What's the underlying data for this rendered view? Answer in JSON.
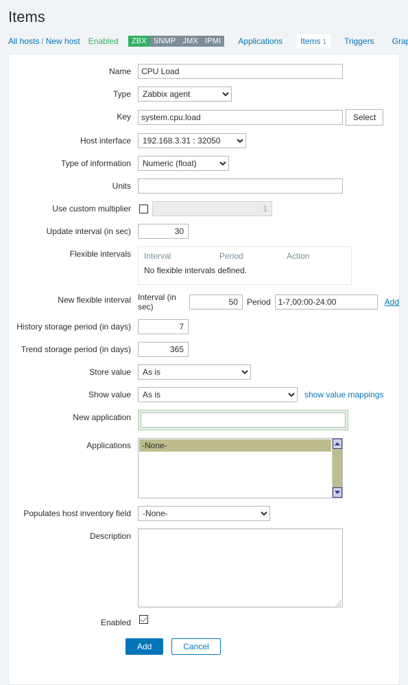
{
  "header": {
    "title": "Items"
  },
  "breadcrumb": {
    "all_hosts": "All hosts",
    "separator": "/",
    "host_name": "New host",
    "status": "Enabled",
    "interface_badges": [
      {
        "label": "ZBX",
        "active": true
      },
      {
        "label": "SNMP",
        "active": false
      },
      {
        "label": "JMX",
        "active": false
      },
      {
        "label": "IPMI",
        "active": false
      }
    ],
    "tabs": [
      {
        "label": "Applications",
        "active": false,
        "count": ""
      },
      {
        "label": "Items",
        "active": true,
        "count": "1"
      },
      {
        "label": "Triggers",
        "active": false,
        "count": ""
      },
      {
        "label": "Graphs",
        "active": false,
        "count": ""
      }
    ]
  },
  "form": {
    "name": {
      "label": "Name",
      "value": "CPU Load"
    },
    "type": {
      "label": "Type",
      "value": "Zabbix agent"
    },
    "key": {
      "label": "Key",
      "value": "system.cpu.load",
      "select_button": "Select"
    },
    "host_interface": {
      "label": "Host interface",
      "value": "192.168.3.31 : 32050"
    },
    "type_of_information": {
      "label": "Type of information",
      "value": "Numeric (float)"
    },
    "units": {
      "label": "Units",
      "value": ""
    },
    "custom_multiplier": {
      "label": "Use custom multiplier",
      "checked": false,
      "value": "1",
      "disabled": true
    },
    "update_interval": {
      "label": "Update interval (in sec)",
      "value": "30"
    },
    "flexible_intervals": {
      "label": "Flexible intervals",
      "columns": [
        "Interval",
        "Period",
        "Action"
      ],
      "empty_message": "No flexible intervals defined.",
      "rows": []
    },
    "new_flexible_interval": {
      "label": "New flexible interval",
      "interval_label": "Interval (in sec)",
      "interval_value": "50",
      "period_label": "Period",
      "period_value": "1-7,00:00-24:00",
      "add_link": "Add"
    },
    "history_storage": {
      "label": "History storage period (in days)",
      "value": "7"
    },
    "trend_storage": {
      "label": "Trend storage period (in days)",
      "value": "365"
    },
    "store_value": {
      "label": "Store value",
      "value": "As is"
    },
    "show_value": {
      "label": "Show value",
      "value": "As is",
      "mappings_link": "show value mappings"
    },
    "new_application": {
      "label": "New application",
      "value": "",
      "focused": true
    },
    "applications": {
      "label": "Applications",
      "options": [
        "-None-"
      ],
      "selected": "-None-"
    },
    "host_inventory_field": {
      "label": "Populates host inventory field",
      "value": "-None-"
    },
    "description": {
      "label": "Description",
      "value": ""
    },
    "enabled": {
      "label": "Enabled",
      "checked": true
    }
  },
  "actions": {
    "submit": "Add",
    "cancel": "Cancel"
  },
  "colors": {
    "accent": "#0275b8",
    "success": "#34af67",
    "badge_inactive": "#7d8e97",
    "focus_ring": "#a7cfa7",
    "listbox_select": "#bdbd8e"
  }
}
